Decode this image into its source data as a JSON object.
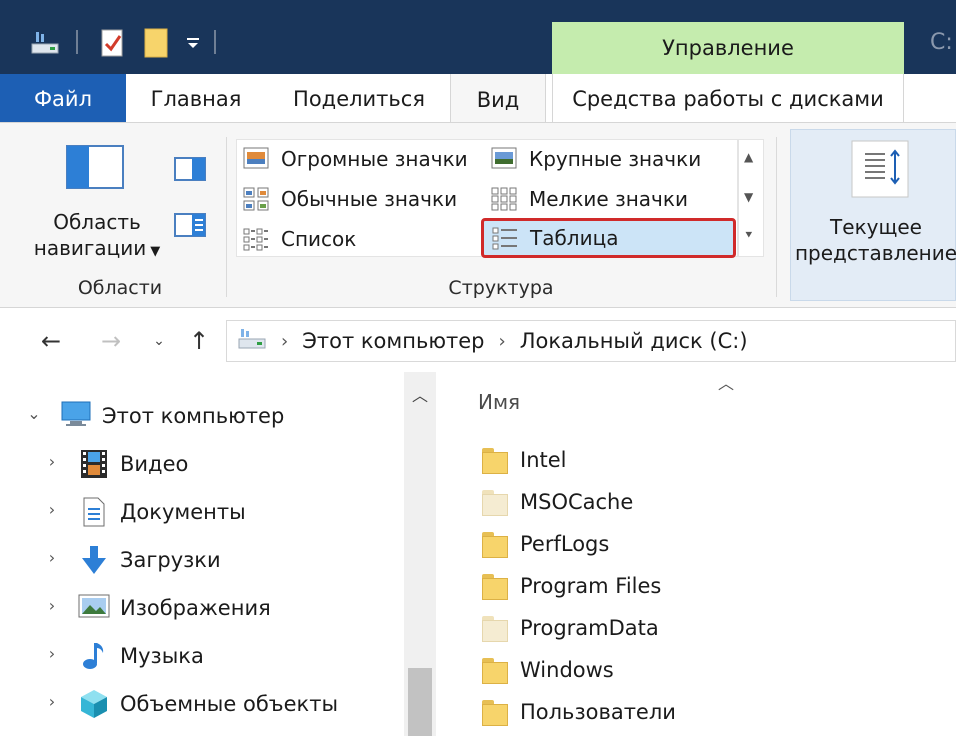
{
  "window": {
    "title_fragment": "C:",
    "context_tab_group": "Управление"
  },
  "ribbon_tabs": [
    {
      "label": "Файл"
    },
    {
      "label": "Главная"
    },
    {
      "label": "Поделиться"
    },
    {
      "label": "Вид"
    },
    {
      "label": "Средства работы с дисками"
    }
  ],
  "ribbon": {
    "panes_group": {
      "nav_pane_button": {
        "line1": "Область",
        "line2": "навигации"
      },
      "label": "Области"
    },
    "layout_group": {
      "items": [
        {
          "label": "Огромные значки"
        },
        {
          "label": "Крупные значки"
        },
        {
          "label": "Обычные значки"
        },
        {
          "label": "Мелкие значки"
        },
        {
          "label": "Список"
        },
        {
          "label": "Таблица"
        }
      ],
      "selected": "Таблица",
      "label": "Структура"
    },
    "current_view": {
      "line1": "Текущее",
      "line2": "представление"
    }
  },
  "address_bar": {
    "crumbs": [
      "Этот компьютер",
      "Локальный диск (C:)"
    ]
  },
  "nav_tree": {
    "root": "Этот компьютер",
    "items": [
      {
        "label": "Видео",
        "icon": "video-icon"
      },
      {
        "label": "Документы",
        "icon": "documents-icon"
      },
      {
        "label": "Загрузки",
        "icon": "downloads-icon"
      },
      {
        "label": "Изображения",
        "icon": "pictures-icon"
      },
      {
        "label": "Музыка",
        "icon": "music-icon"
      },
      {
        "label": "Объемные объекты",
        "icon": "3d-objects-icon"
      }
    ]
  },
  "content": {
    "column_name": "Имя",
    "files": [
      {
        "name": "Intel",
        "hidden": false
      },
      {
        "name": "MSOCache",
        "hidden": true
      },
      {
        "name": "PerfLogs",
        "hidden": false
      },
      {
        "name": "Program Files",
        "hidden": false
      },
      {
        "name": "ProgramData",
        "hidden": true
      },
      {
        "name": "Windows",
        "hidden": false
      },
      {
        "name": "Пользователи",
        "hidden": false
      }
    ]
  },
  "colors": {
    "titlebar": "#19355a",
    "file_tab": "#1d5fb4",
    "context_tab": "#c5ecae",
    "selection": "#cce4f7",
    "highlight_border": "#d02a2a",
    "folder": "#f7d46b"
  }
}
